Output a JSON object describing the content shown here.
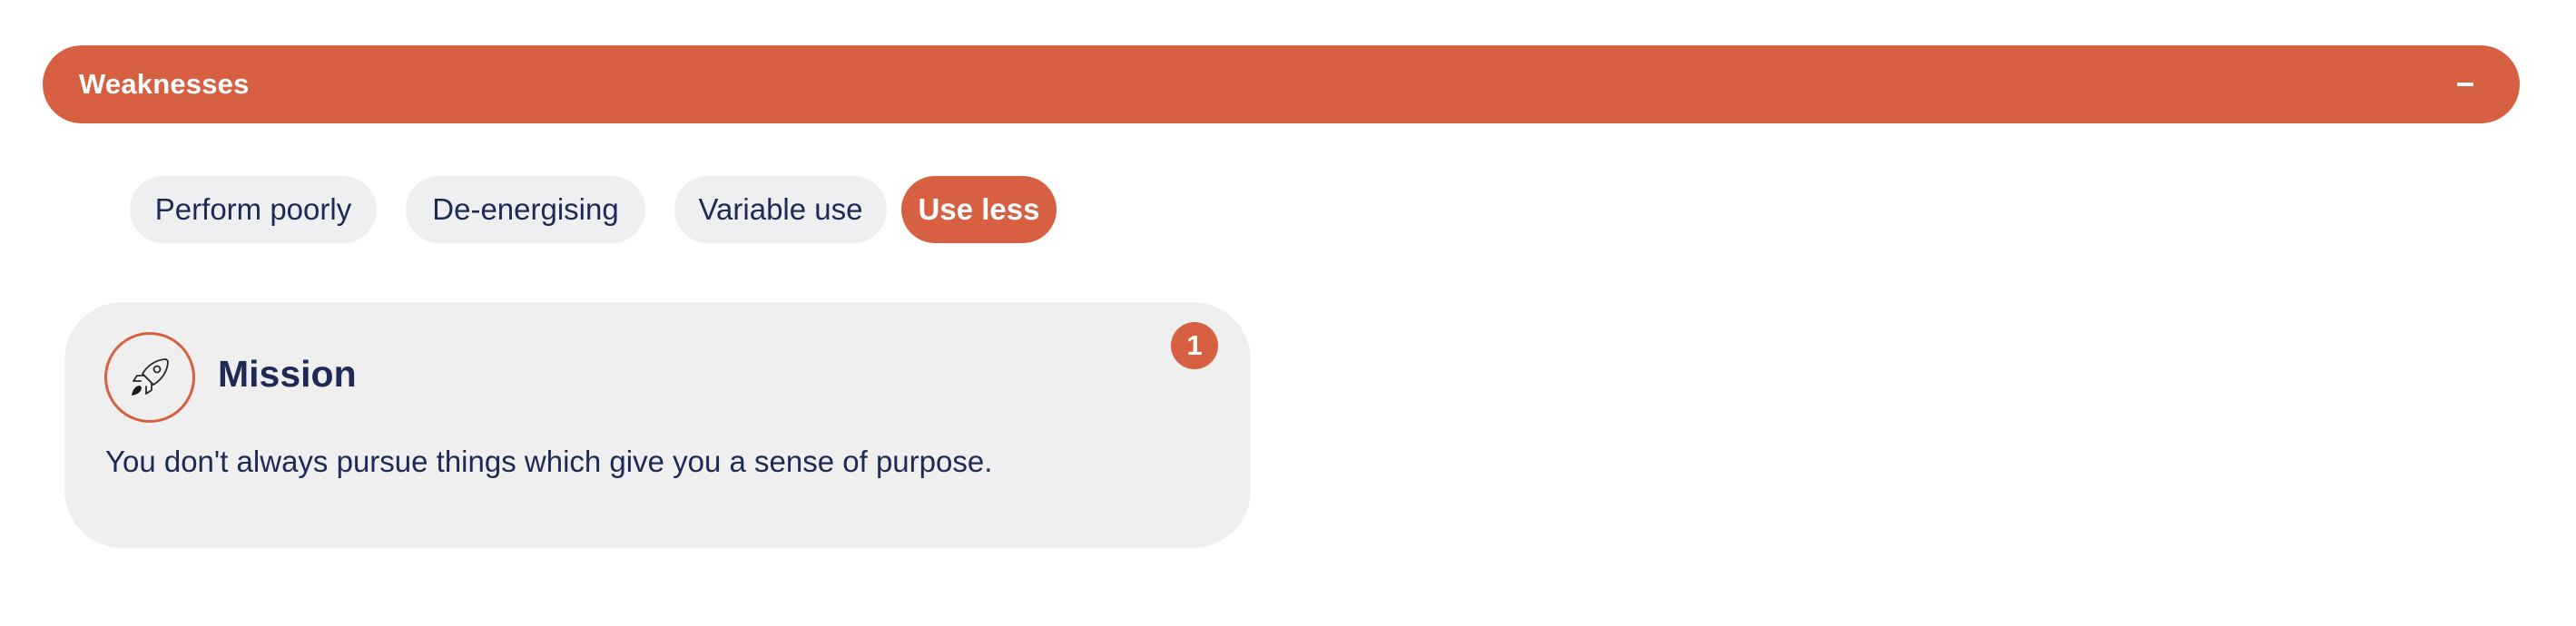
{
  "accordion": {
    "title": "Weaknesses",
    "toggle_icon": "minus-icon"
  },
  "filters": [
    {
      "label": "Perform poorly",
      "active": false
    },
    {
      "label": "De-energising",
      "active": false
    },
    {
      "label": "Variable use",
      "active": false
    },
    {
      "label": "Use less",
      "active": true
    }
  ],
  "card": {
    "icon": "rocket-icon",
    "title": "Mission",
    "description": "You don't always pursue things which give you a sense of purpose.",
    "badge_count": "1"
  },
  "colors": {
    "accent": "#d66041",
    "text": "#1d2a55",
    "chip_bg": "#eeeff1",
    "card_bg": "#efefef"
  }
}
